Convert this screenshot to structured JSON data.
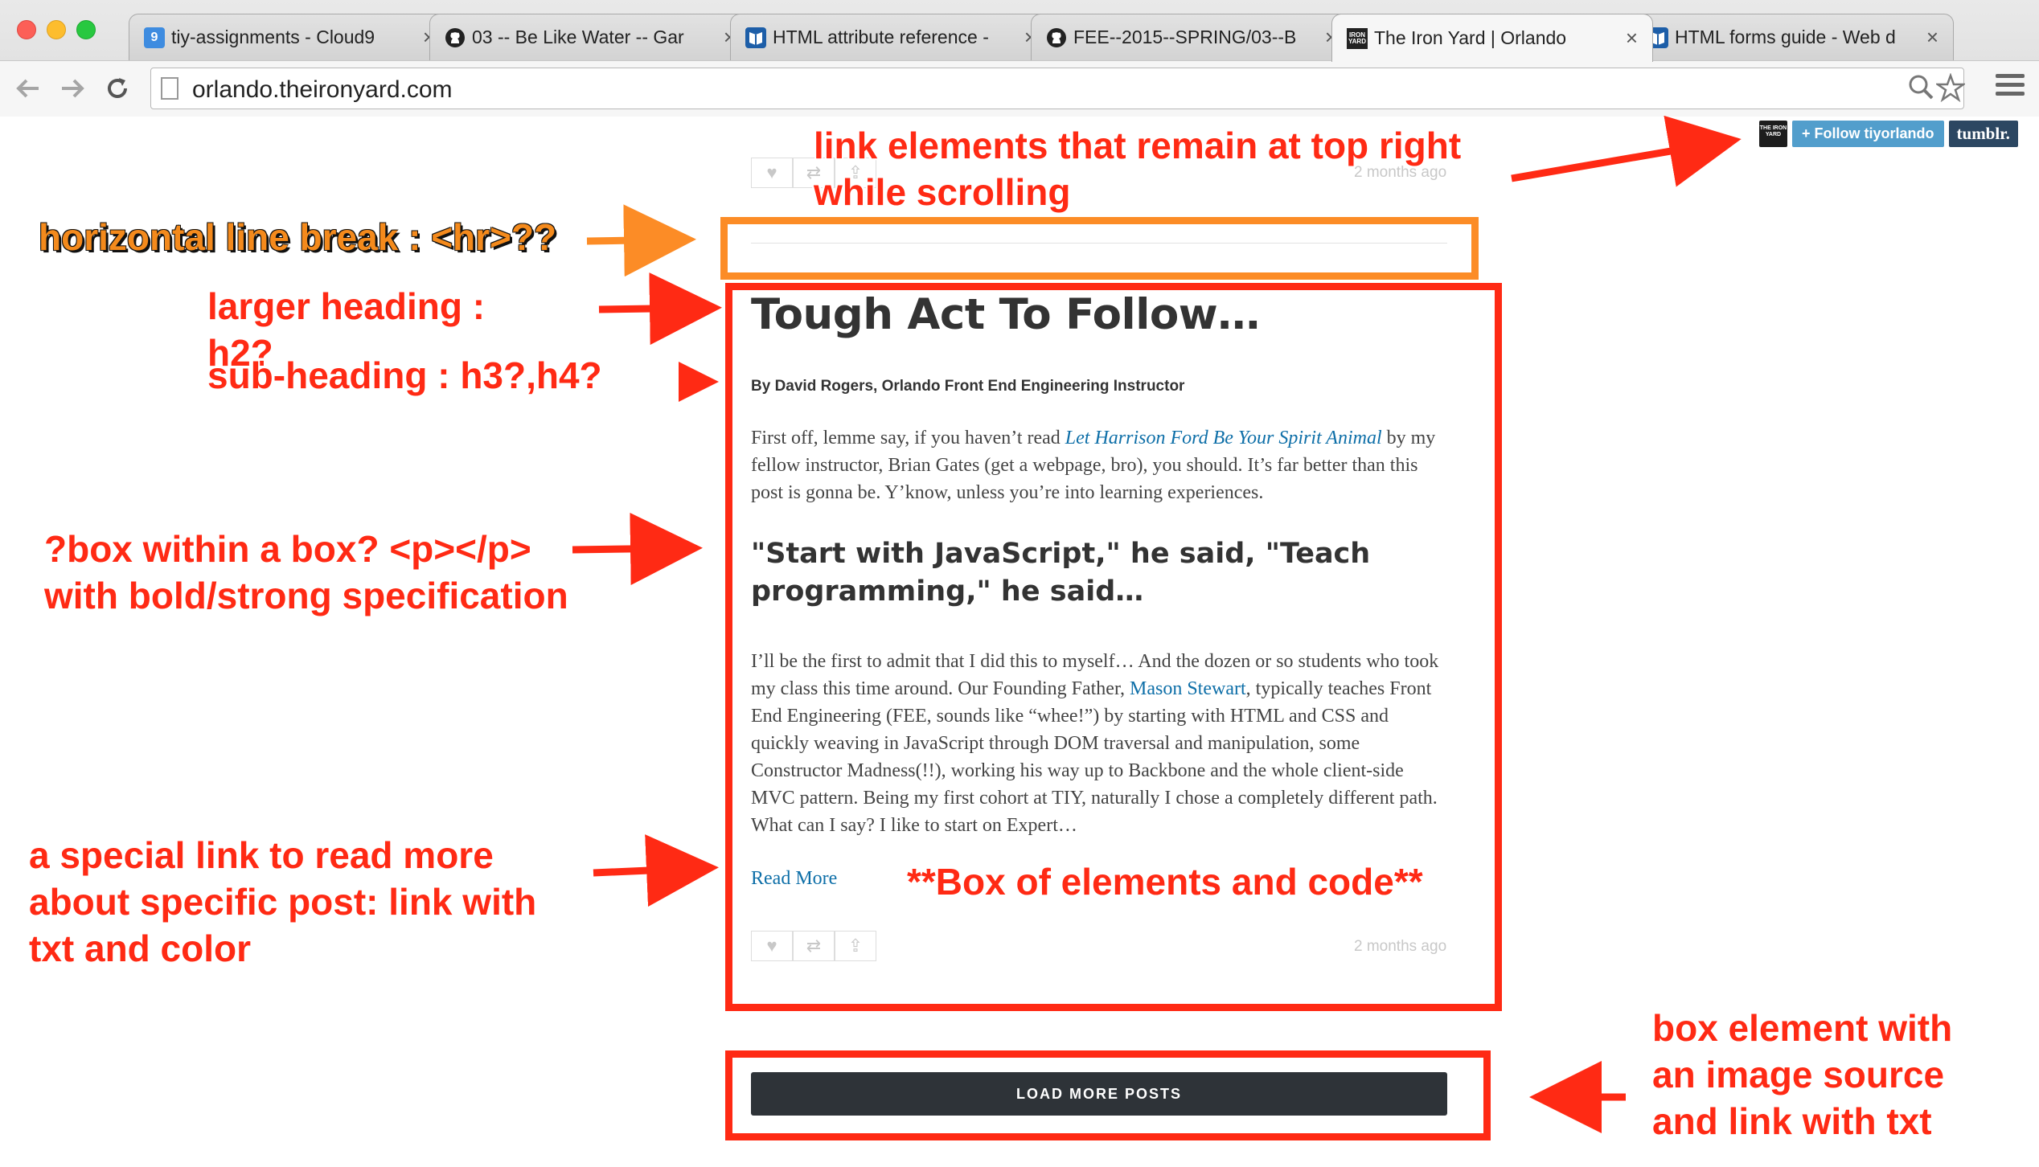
{
  "browser": {
    "tabs": [
      {
        "title": "tiy-assignments - Cloud9",
        "favicon": "cloud9-icon"
      },
      {
        "title": "03 -- Be Like Water -- Gar",
        "favicon": "github-icon"
      },
      {
        "title": "HTML attribute reference -",
        "favicon": "mdn-icon"
      },
      {
        "title": "FEE--2015--SPRING/03--B",
        "favicon": "github-icon"
      },
      {
        "title": "The Iron Yard | Orlando",
        "favicon": "ironyard-icon",
        "active": true
      },
      {
        "title": "HTML forms guide - Web d",
        "favicon": "mdn-icon"
      }
    ],
    "close_glyph": "×",
    "url": "orlando.theironyard.com"
  },
  "tumblr_controls": {
    "logo_text": "THE IRON YARD",
    "follow_label": "+ Follow tiyorlando",
    "tumblr_label": "tumblr."
  },
  "previous_post": {
    "timestamp": "2 months ago"
  },
  "post": {
    "title": "Tough Act To Follow…",
    "byline": "By David Rogers, Orlando Front End Engineering Instructor",
    "p1_before": "First off, lemme say, if you haven’t read ",
    "p1_link": "Let Harrison Ford Be Your Spirit Animal",
    "p1_after": " by my fellow instructor, Brian Gates (get a webpage, bro), you should. It’s far better than this post is gonna be. Y’know, unless you’re into learning experiences.",
    "subheading": "\"Start with JavaScript,\" he said, \"Teach programming,\" he said…",
    "p2_before": "I’ll be the first to admit that I did this to myself… And the dozen or so students who took my class this time around. Our Founding Father, ",
    "p2_link": "Mason Stewart",
    "p2_after": ", typically teaches Front End Engineering (FEE, sounds like “whee!”) by starting with HTML and CSS and quickly weaving in JavaScript through DOM traversal and manipulation, some Constructor Madness(!!), working his way up to Backbone and the whole client-side MVC pattern. Being my first cohort at TIY, naturally I chose a completely different path. What can I say? I like to start on Expert…",
    "read_more": "Read More",
    "timestamp": "2 months ago"
  },
  "load_more_label": "LOAD MORE POSTS",
  "annotations": {
    "top_right": "link elements that remain at top right\nwhile scrolling",
    "hr": "horizontal line break : <hr>??",
    "heading": "larger heading :\nh2?",
    "subheading": "sub-heading : h3?,h4?",
    "box_in_box": "?box within a box? <p></p>\nwith bold/strong specification",
    "read_more": "a special link to read more\nabout specific post: link with\ntxt and color",
    "box_elements": "**Box of elements and code**",
    "image_box": "box element with\nan image source\nand link with txt"
  },
  "colors": {
    "annotation_red": "#ff2a14",
    "annotation_orange": "#fc8c26",
    "link_blue": "#0e6fa8",
    "load_more_bg": "#2e3338",
    "tumblr_follow": "#529ecc",
    "tumblr_brand": "#2c4762"
  }
}
